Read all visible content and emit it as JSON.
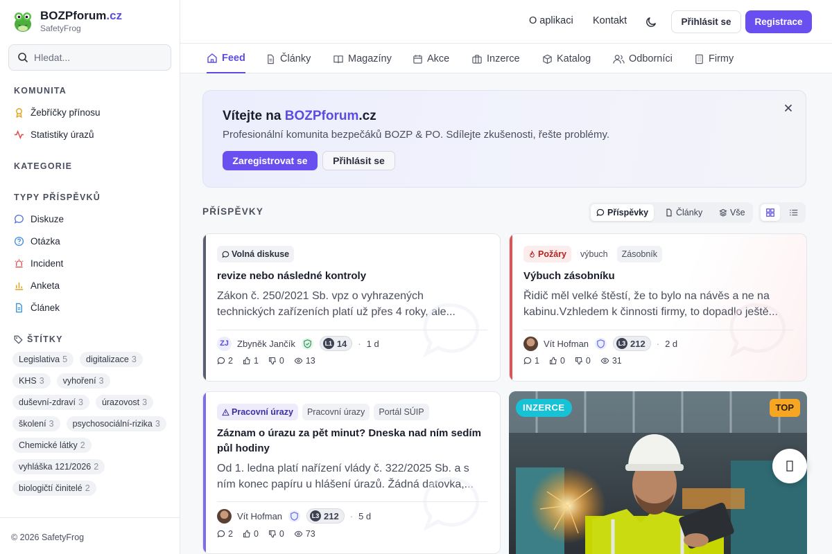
{
  "brand": {
    "name": "BOZPforum",
    "tld": ".cz",
    "subtitle": "SafetyFrog"
  },
  "search": {
    "placeholder": "Hledat..."
  },
  "sidebar": {
    "section_community": "KOMUNITA",
    "community_items": [
      {
        "label": "Žebříčky přínosu",
        "icon": "award-icon"
      },
      {
        "label": "Statistiky úrazů",
        "icon": "activity-icon"
      }
    ],
    "section_categories": "KATEGORIE",
    "section_types": "TYPY PŘÍSPĚVKŮ",
    "type_items": [
      {
        "label": "Diskuze",
        "icon": "chat-icon"
      },
      {
        "label": "Otázka",
        "icon": "question-icon"
      },
      {
        "label": "Incident",
        "icon": "siren-icon"
      },
      {
        "label": "Anketa",
        "icon": "bar-chart-icon"
      },
      {
        "label": "Článek",
        "icon": "document-icon"
      }
    ],
    "section_tags": "ŠTÍTKY",
    "tags": [
      {
        "label": "Legislativa",
        "count": "5"
      },
      {
        "label": "digitalizace",
        "count": "3"
      },
      {
        "label": "KHS",
        "count": "3"
      },
      {
        "label": "vyhoření",
        "count": "3"
      },
      {
        "label": "duševní-zdraví",
        "count": "3"
      },
      {
        "label": "úrazovost",
        "count": "3"
      },
      {
        "label": "školení",
        "count": "3"
      },
      {
        "label": "psychosociální-rizika",
        "count": "3"
      },
      {
        "label": "Chemické látky",
        "count": "2"
      },
      {
        "label": "vyhláška 121/2026",
        "count": "2"
      },
      {
        "label": "biologičtí činitelé",
        "count": "2"
      }
    ],
    "footer": "© 2026 SafetyFrog"
  },
  "header": {
    "about": "O aplikaci",
    "contact": "Kontakt",
    "login": "Přihlásit se",
    "register": "Registrace"
  },
  "tabs": [
    {
      "label": "Feed",
      "icon": "home-icon",
      "active": true
    },
    {
      "label": "Články",
      "icon": "document-icon"
    },
    {
      "label": "Magazíny",
      "icon": "book-icon"
    },
    {
      "label": "Akce",
      "icon": "calendar-icon"
    },
    {
      "label": "Inzerce",
      "icon": "briefcase-icon"
    },
    {
      "label": "Katalog",
      "icon": "package-icon"
    },
    {
      "label": "Odborníci",
      "icon": "users-icon"
    },
    {
      "label": "Firmy",
      "icon": "building-icon"
    }
  ],
  "welcome": {
    "title_prefix": "Vítejte na ",
    "title_brand": "BOZPforum",
    "title_suffix": ".cz",
    "subtitle": "Profesionální komunita bezpečáků BOZP & PO. Sdílejte zkušenosti, řešte problémy.",
    "register_btn": "Zaregistrovat se",
    "login_btn": "Přihlásit se"
  },
  "posts": {
    "heading": "PŘÍSPĚVKY",
    "filters": [
      {
        "label": "Příspěvky",
        "active": true
      },
      {
        "label": "Články"
      },
      {
        "label": "Vše"
      }
    ],
    "cards": [
      {
        "accent": "#5a5e6e",
        "badges": [
          "Volná diskuse"
        ],
        "title": "revize nebo následné kontroly",
        "text": "Zákon č. 250/2021 Sb. vpz o vyhrazených technických zařízeních platí už přes 4 roky, ale...",
        "author": "Zbyněk Jančík",
        "initials": "ZJ",
        "level": "L1",
        "points": "14",
        "age": "1 d",
        "comments": "2",
        "likes": "1",
        "dislikes": "0",
        "views": "13"
      },
      {
        "accent": "#e15252",
        "badges": [
          "Požáry",
          "výbuch",
          "Zásobník"
        ],
        "title": "Výbuch zásobníku",
        "text": "Řidič měl velké štěstí, že to bylo na návěs a ne na kabinu.Vzhledem k činnosti firmy, to dopadlo ještě...",
        "author": "Vít Hofman",
        "level": "L3",
        "points": "212",
        "age": "2 d",
        "comments": "1",
        "likes": "0",
        "dislikes": "0",
        "views": "31"
      },
      {
        "accent": "#7b6cf0",
        "badges": [
          "Pracovní úrazy",
          "Pracovní úrazy",
          "Portál SÚIP"
        ],
        "title": "Záznam o úrazu za pět minut? Dneska nad ním sedím půl hodiny",
        "text": "Od 1. ledna platí nařízení vlády č. 322/2025 Sb. a s ním konec papíru u hlášení úrazů. Žádná datovka,...",
        "author": "Vít Hofman",
        "level": "L3",
        "points": "212",
        "age": "5 d",
        "comments": "2",
        "likes": "0",
        "dislikes": "0",
        "views": "73"
      }
    ],
    "ad": {
      "badge": "INZERCE",
      "top": "TOP"
    }
  }
}
